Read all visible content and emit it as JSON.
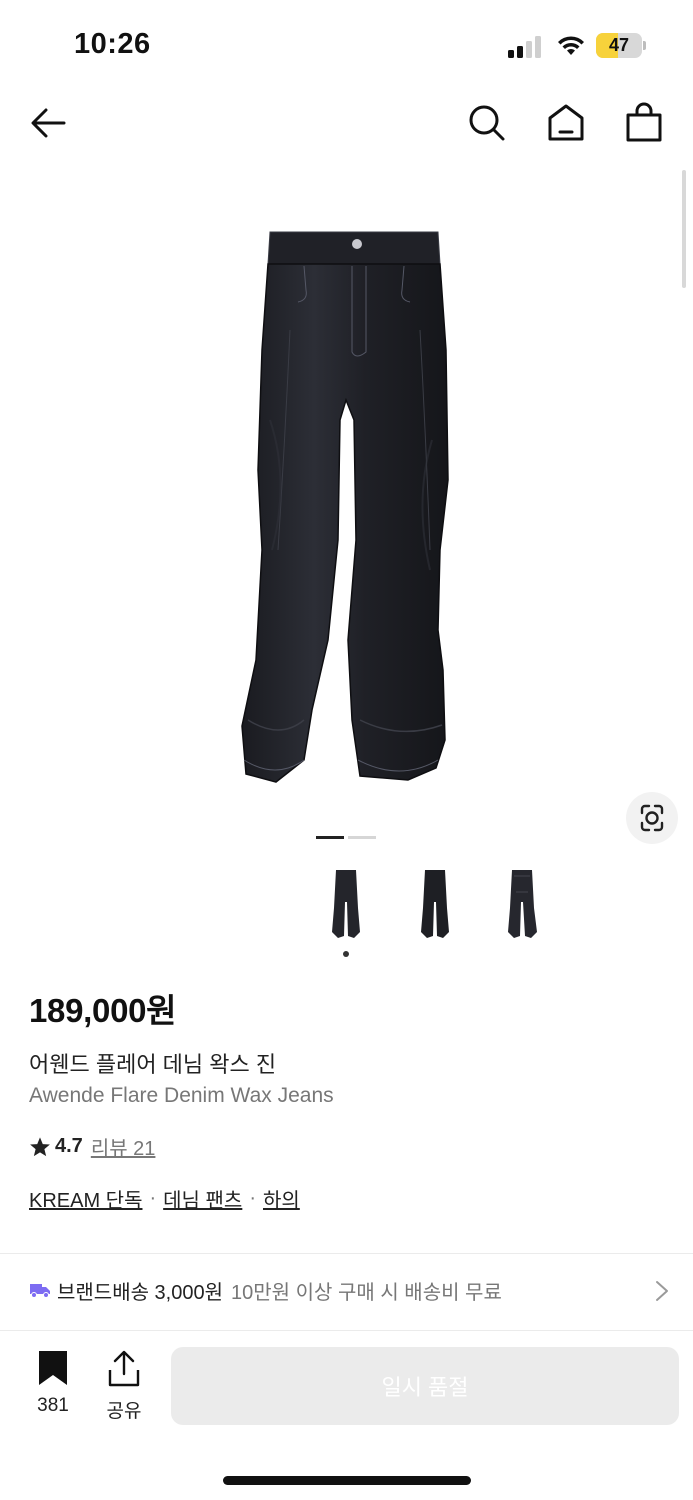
{
  "status_bar": {
    "time": "10:26",
    "battery_level": "47",
    "battery_fraction": 0.47,
    "battery_color": "#f7d23b"
  },
  "nav": {
    "icons": [
      "back-arrow-icon",
      "search-icon",
      "home-icon",
      "shopping-bag-icon"
    ]
  },
  "gallery": {
    "current_image": 1,
    "image_count": 2,
    "thumbnails": 3,
    "selected_thumbnail": 1
  },
  "product": {
    "price": "189,000원",
    "name_ko": "어웬드 플레어 데님 왁스 진",
    "name_en": "Awende Flare Denim Wax Jeans",
    "rating": "4.7",
    "review_label": "리뷰 21",
    "tags": [
      "KREAM 단독",
      "데님 팬츠",
      "하의"
    ],
    "tag_separator": "·"
  },
  "shipping": {
    "label": "브랜드배송 3,000원",
    "note": "10만원 이상 구매 시 배송비 무료",
    "icon_color": "#7d6cf2"
  },
  "bottom_bar": {
    "bookmark_count": "381",
    "share_label": "공유",
    "cta_label": "일시 품절"
  }
}
